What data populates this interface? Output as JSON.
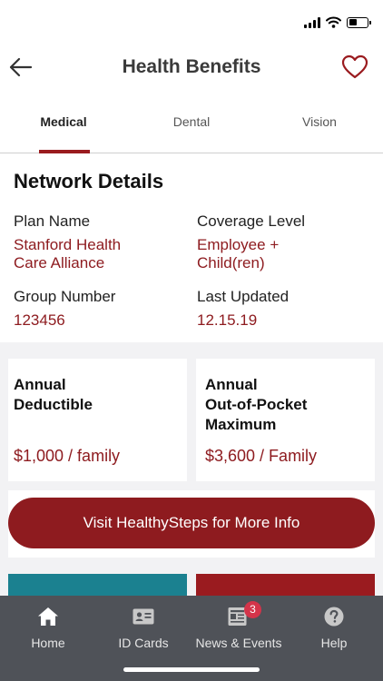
{
  "status": {
    "signal_bars": 4,
    "wifi": true,
    "battery_level": 0.45
  },
  "header": {
    "title": "Health Benefits",
    "back_icon": "arrow-left-icon",
    "favorite_icon": "heart-outline-icon",
    "accent": "#9a1b1f"
  },
  "tabs": [
    {
      "label": "Medical",
      "active": true
    },
    {
      "label": "Dental",
      "active": false
    },
    {
      "label": "Vision",
      "active": false
    }
  ],
  "network": {
    "title": "Network Details",
    "plan_name_label": "Plan Name",
    "plan_name_line1": "Stanford Health",
    "plan_name_line2": "Care Alliance",
    "coverage_label": "Coverage Level",
    "coverage_line1": "Employee +",
    "coverage_line2": "Child(ren)",
    "group_label": "Group Number",
    "group_value": "123456",
    "updated_label": "Last Updated",
    "updated_value": "12.15.19"
  },
  "cards": {
    "deductible": {
      "title_line1": "Annual",
      "title_line2": "Deductible",
      "value": "$1,000 / family"
    },
    "oop": {
      "title_line1": "Annual",
      "title_line2": "Out-of-Pocket",
      "title_line3": "Maximum",
      "value": "$3,600 / Family"
    }
  },
  "cta": {
    "label": "Visit HealthySteps for More Info"
  },
  "tiles": {
    "left_color": "#1b8190",
    "right_color": "#9a1b1f"
  },
  "tabbar": {
    "items": [
      {
        "label": "Home",
        "icon": "home-icon"
      },
      {
        "label": "ID Cards",
        "icon": "id-card-icon"
      },
      {
        "label": "News & Events",
        "icon": "newspaper-icon",
        "badge": "3"
      },
      {
        "label": "Help",
        "icon": "help-icon"
      }
    ]
  }
}
